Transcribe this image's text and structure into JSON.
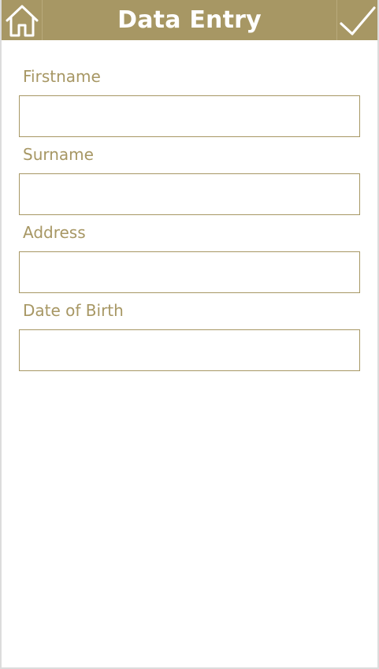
{
  "header": {
    "title": "Data Entry",
    "home_icon": "home-icon",
    "confirm_icon": "check-icon",
    "bg_color": "#a79764"
  },
  "form": {
    "fields": [
      {
        "label": "Firstname",
        "value": "",
        "placeholder": ""
      },
      {
        "label": "Surname",
        "value": "",
        "placeholder": ""
      },
      {
        "label": "Address",
        "value": "",
        "placeholder": ""
      },
      {
        "label": "Date of Birth",
        "value": "",
        "placeholder": ""
      }
    ],
    "accent_color": "#a79764"
  }
}
